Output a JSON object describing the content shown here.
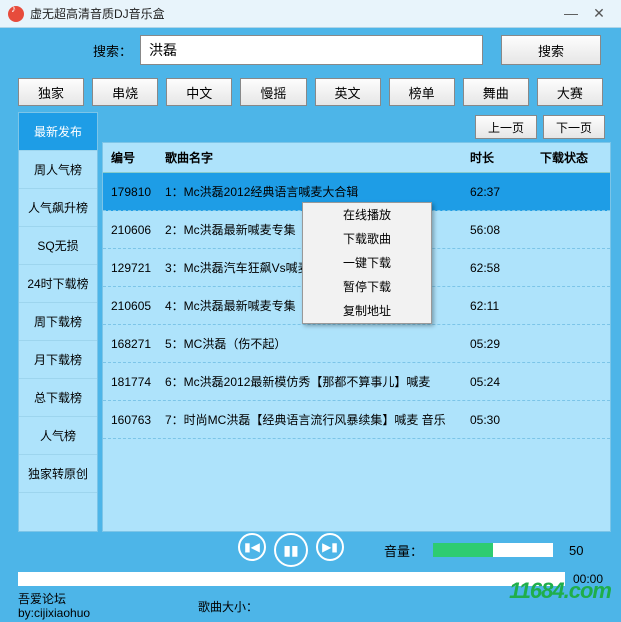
{
  "window": {
    "title": "虚无超高清音质DJ音乐盒"
  },
  "search": {
    "label": "搜索：",
    "value": "洪磊",
    "button": "搜索"
  },
  "categories": [
    "独家",
    "串烧",
    "中文",
    "慢摇",
    "英文",
    "榜单",
    "舞曲",
    "大赛"
  ],
  "sidebar": {
    "items": [
      "最新发布",
      "周人气榜",
      "人气飙升榜",
      "SQ无损",
      "24时下载榜",
      "周下载榜",
      "月下载榜",
      "总下载榜",
      "人气榜",
      "独家转原创"
    ],
    "activeIndex": 0
  },
  "pager": {
    "prev": "上一页",
    "next": "下一页"
  },
  "table": {
    "headers": {
      "id": "编号",
      "name": "歌曲名字",
      "duration": "时长",
      "status": "下载状态"
    },
    "rows": [
      {
        "id": "179810",
        "name": "1：Mc洪磊2012经典语言喊麦大合辑",
        "duration": "62:37"
      },
      {
        "id": "210606",
        "name": "2：Mc洪磊最新喊麦专集（三）",
        "duration": "56:08"
      },
      {
        "id": "129721",
        "name": "3：Mc洪磊汽车狂飙Vs喊麦专辑２０１０特别制作",
        "duration": "62:58"
      },
      {
        "id": "210605",
        "name": "4：Mc洪磊最新喊麦专集（二）",
        "duration": "62:11"
      },
      {
        "id": "168271",
        "name": "5：MC洪磊（伤不起）",
        "duration": "05:29"
      },
      {
        "id": "181774",
        "name": "6：Mc洪磊2012最新模仿秀【那都不算事儿】喊麦",
        "duration": "05:24"
      },
      {
        "id": "160763",
        "name": "7：时尚MC洪磊【经典语言流行风暴续集】喊麦 音乐",
        "duration": "05:30"
      }
    ],
    "selectedIndex": 0
  },
  "contextMenu": {
    "items": [
      "在线播放",
      "下载歌曲",
      "一键下载",
      "暂停下载",
      "复制地址"
    ]
  },
  "player": {
    "volumeLabel": "音量：",
    "volume": 50,
    "progress": "00:00"
  },
  "footer": {
    "forum": "吾爱论坛",
    "by": "by:cijixiaohuo",
    "sizeLabel": "歌曲大小："
  },
  "watermark": "11684.com"
}
